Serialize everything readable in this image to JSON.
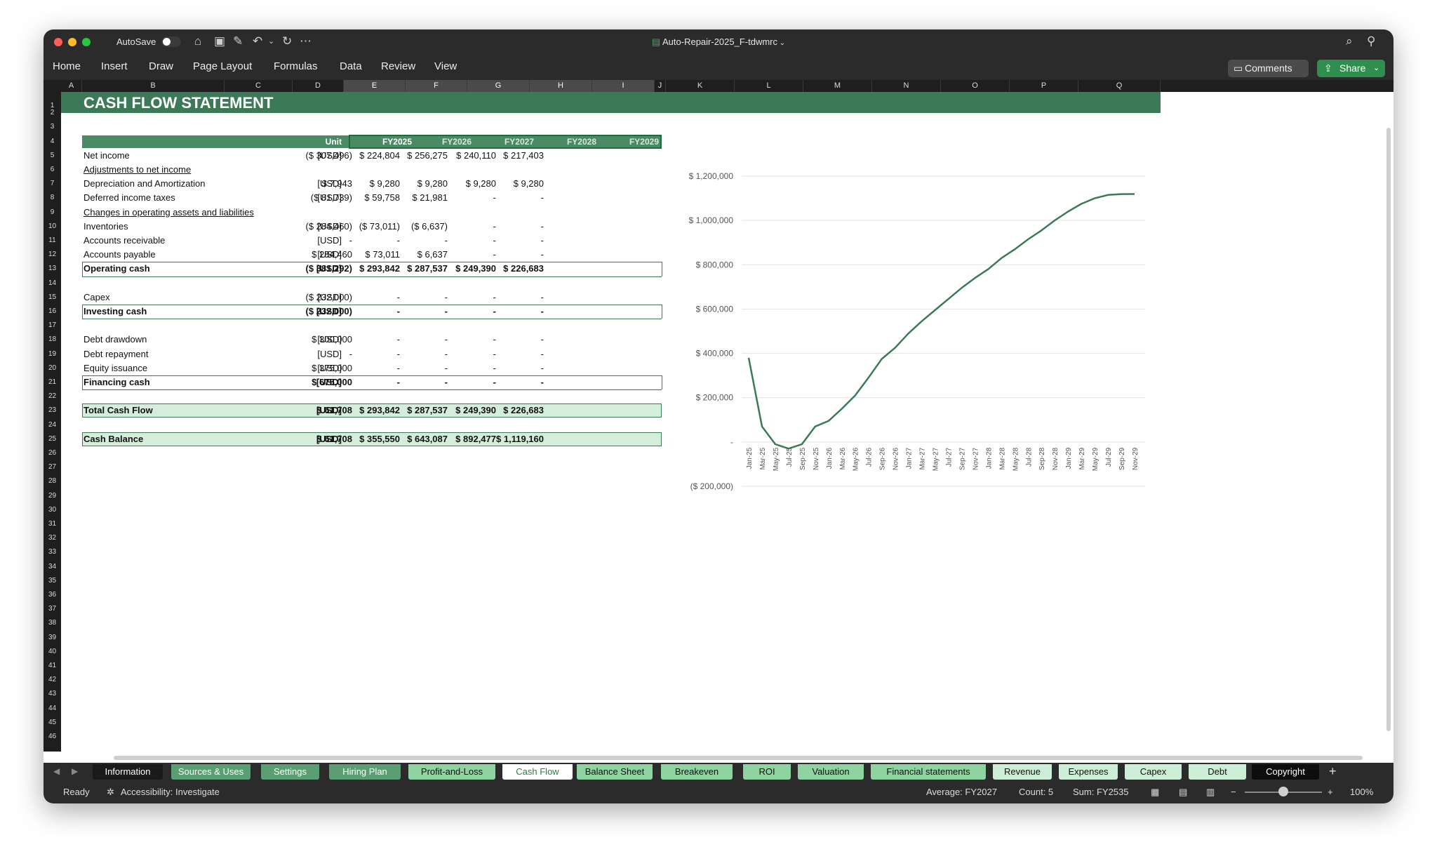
{
  "window": {
    "autosave_label": "AutoSave",
    "doc_title": "Auto-Repair-2025_F-tdwmrc"
  },
  "menu": [
    "Home",
    "Insert",
    "Draw",
    "Page Layout",
    "Formulas",
    "Data",
    "Review",
    "View"
  ],
  "buttons": {
    "comments": "Comments",
    "share": "Share"
  },
  "columns": [
    "A",
    "B",
    "C",
    "D",
    "E",
    "F",
    "G",
    "H",
    "I",
    "J",
    "K",
    "L",
    "M",
    "N",
    "O",
    "P",
    "Q"
  ],
  "rows": [
    "1",
    "2",
    "3",
    "4",
    "5",
    "6",
    "7",
    "8",
    "9",
    "10",
    "11",
    "12",
    "13",
    "14",
    "15",
    "16",
    "17",
    "18",
    "19",
    "20",
    "21",
    "22",
    "23",
    "24",
    "25",
    "26",
    "27",
    "28",
    "29",
    "30",
    "31",
    "32",
    "33",
    "34",
    "35",
    "36",
    "37",
    "38",
    "39",
    "40",
    "41",
    "42",
    "43",
    "44",
    "45",
    "46"
  ],
  "sheet": {
    "title": "CASH FLOW STATEMENT",
    "unit_header": "Unit",
    "years": [
      "FY2025",
      "FY2026",
      "FY2027",
      "FY2028",
      "FY2029"
    ],
    "lines": [
      {
        "label": "Net income",
        "unit": "[USD]",
        "values": [
          "($ 307,496)",
          "$ 224,804",
          "$ 256,275",
          "$ 240,110",
          "$ 217,403"
        ]
      },
      {
        "label": "Adjustments to net income",
        "unit": "",
        "values": [
          "",
          "",
          "",
          "",
          ""
        ]
      },
      {
        "label": "Depreciation and Amortization",
        "unit": "[USD]",
        "values": [
          "$ 7,943",
          "$ 9,280",
          "$ 9,280",
          "$ 9,280",
          "$ 9,280"
        ]
      },
      {
        "label": "Deferred income taxes",
        "unit": "[USD]",
        "values": [
          "($ 81,739)",
          "$ 59,758",
          "$ 21,981",
          "-",
          "-"
        ]
      },
      {
        "label": "Changes in operating assets and liabilities",
        "unit": "",
        "values": [
          "",
          "",
          "",
          "",
          ""
        ]
      },
      {
        "label": "Inventories",
        "unit": "[USD]",
        "values": [
          "($ 284,460)",
          "($ 73,011)",
          "($ 6,637)",
          "-",
          "-"
        ]
      },
      {
        "label": "Accounts receivable",
        "unit": "[USD]",
        "values": [
          "-",
          "-",
          "-",
          "-",
          "-"
        ]
      },
      {
        "label": "Accounts payable",
        "unit": "[USD]",
        "values": [
          "$ 284,460",
          "$ 73,011",
          "$ 6,637",
          "-",
          "-"
        ]
      },
      {
        "label": "Operating cash",
        "unit": "[USD]",
        "values": [
          "($ 381,292)",
          "$ 293,842",
          "$ 287,537",
          "$ 249,390",
          "$ 226,683"
        ]
      },
      {
        "label": "Capex",
        "unit": "[USD]",
        "values": [
          "($ 232,000)",
          "-",
          "-",
          "-",
          "-"
        ]
      },
      {
        "label": "Investing cash",
        "unit": "[USD]",
        "values": [
          "($ 232,000)",
          "-",
          "-",
          "-",
          "-"
        ]
      },
      {
        "label": "Debt drawdown",
        "unit": "[USD]",
        "values": [
          "$ 300,000",
          "-",
          "-",
          "-",
          "-"
        ]
      },
      {
        "label": "Debt repayment",
        "unit": "[USD]",
        "values": [
          "-",
          "-",
          "-",
          "-",
          "-"
        ]
      },
      {
        "label": "Equity issuance",
        "unit": "[USD]",
        "values": [
          "$ 375,000",
          "-",
          "-",
          "-",
          "-"
        ]
      },
      {
        "label": "Financing cash",
        "unit": "[USD]",
        "values": [
          "$ 675,000",
          "-",
          "-",
          "-",
          "-"
        ]
      },
      {
        "label": "Total Cash Flow",
        "unit": "[USD]",
        "values": [
          "$ 61,708",
          "$ 293,842",
          "$ 287,537",
          "$ 249,390",
          "$ 226,683"
        ]
      },
      {
        "label": "Cash Balance",
        "unit": "[USD]",
        "values": [
          "$ 61,708",
          "$ 355,550",
          "$ 643,087",
          "$ 892,477",
          "$ 1,119,160"
        ]
      }
    ]
  },
  "chart_data": {
    "type": "line",
    "title": "",
    "ylim": [
      -200000,
      1200000
    ],
    "yticks": [
      1200000,
      1000000,
      800000,
      600000,
      400000,
      200000,
      0,
      -200000
    ],
    "ytick_labels": [
      "$ 1,200,000",
      "$ 1,000,000",
      "$ 800,000",
      "$ 600,000",
      "$ 400,000",
      "$ 200,000",
      "-",
      "($ 200,000)"
    ],
    "grid": true,
    "color": "#3c7a57",
    "x": [
      "Jan-25",
      "Mar-25",
      "May-25",
      "Jul-25",
      "Sep-25",
      "Nov-25",
      "Jan-26",
      "Mar-26",
      "May-26",
      "Jul-26",
      "Sep-26",
      "Nov-26",
      "Jan-27",
      "Mar-27",
      "May-27",
      "Jul-27",
      "Sep-27",
      "Nov-27",
      "Jan-28",
      "Mar-28",
      "May-28",
      "Jul-28",
      "Sep-28",
      "Nov-28",
      "Jan-29",
      "Mar-29",
      "May-29",
      "Jul-29",
      "Sep-29",
      "Nov-29"
    ],
    "series": [
      {
        "values": [
          380000,
          70000,
          -10000,
          -30000,
          -10000,
          70000,
          95000,
          150000,
          210000,
          290000,
          375000,
          425000,
          490000,
          545000,
          595000,
          645000,
          695000,
          740000,
          780000,
          830000,
          870000,
          915000,
          955000,
          1000000,
          1040000,
          1075000,
          1100000,
          1115000,
          1119000,
          1119160
        ]
      }
    ]
  },
  "tabs": [
    {
      "label": "Information",
      "style": "dark"
    },
    {
      "label": "Sources & Uses",
      "style": "mid"
    },
    {
      "label": "Settings",
      "style": "mid"
    },
    {
      "label": "Hiring Plan",
      "style": "mid"
    },
    {
      "label": "Profit-and-Loss",
      "style": "light"
    },
    {
      "label": "Cash Flow",
      "style": "active"
    },
    {
      "label": "Balance Sheet",
      "style": "light"
    },
    {
      "label": "Breakeven",
      "style": "light"
    },
    {
      "label": "ROI",
      "style": "light"
    },
    {
      "label": "Valuation",
      "style": "light"
    },
    {
      "label": "Financial statements",
      "style": "light"
    },
    {
      "label": "Revenue",
      "style": "pale"
    },
    {
      "label": "Expenses",
      "style": "pale"
    },
    {
      "label": "Capex",
      "style": "pale"
    },
    {
      "label": "Debt",
      "style": "pale"
    },
    {
      "label": "Copyright",
      "style": "black"
    }
  ],
  "status": {
    "ready": "Ready",
    "accessibility": "Accessibility: Investigate",
    "average": "Average: FY2027",
    "count": "Count: 5",
    "sum": "Sum: FY2535",
    "zoom": "100%",
    "zoom_level": 0.5
  }
}
